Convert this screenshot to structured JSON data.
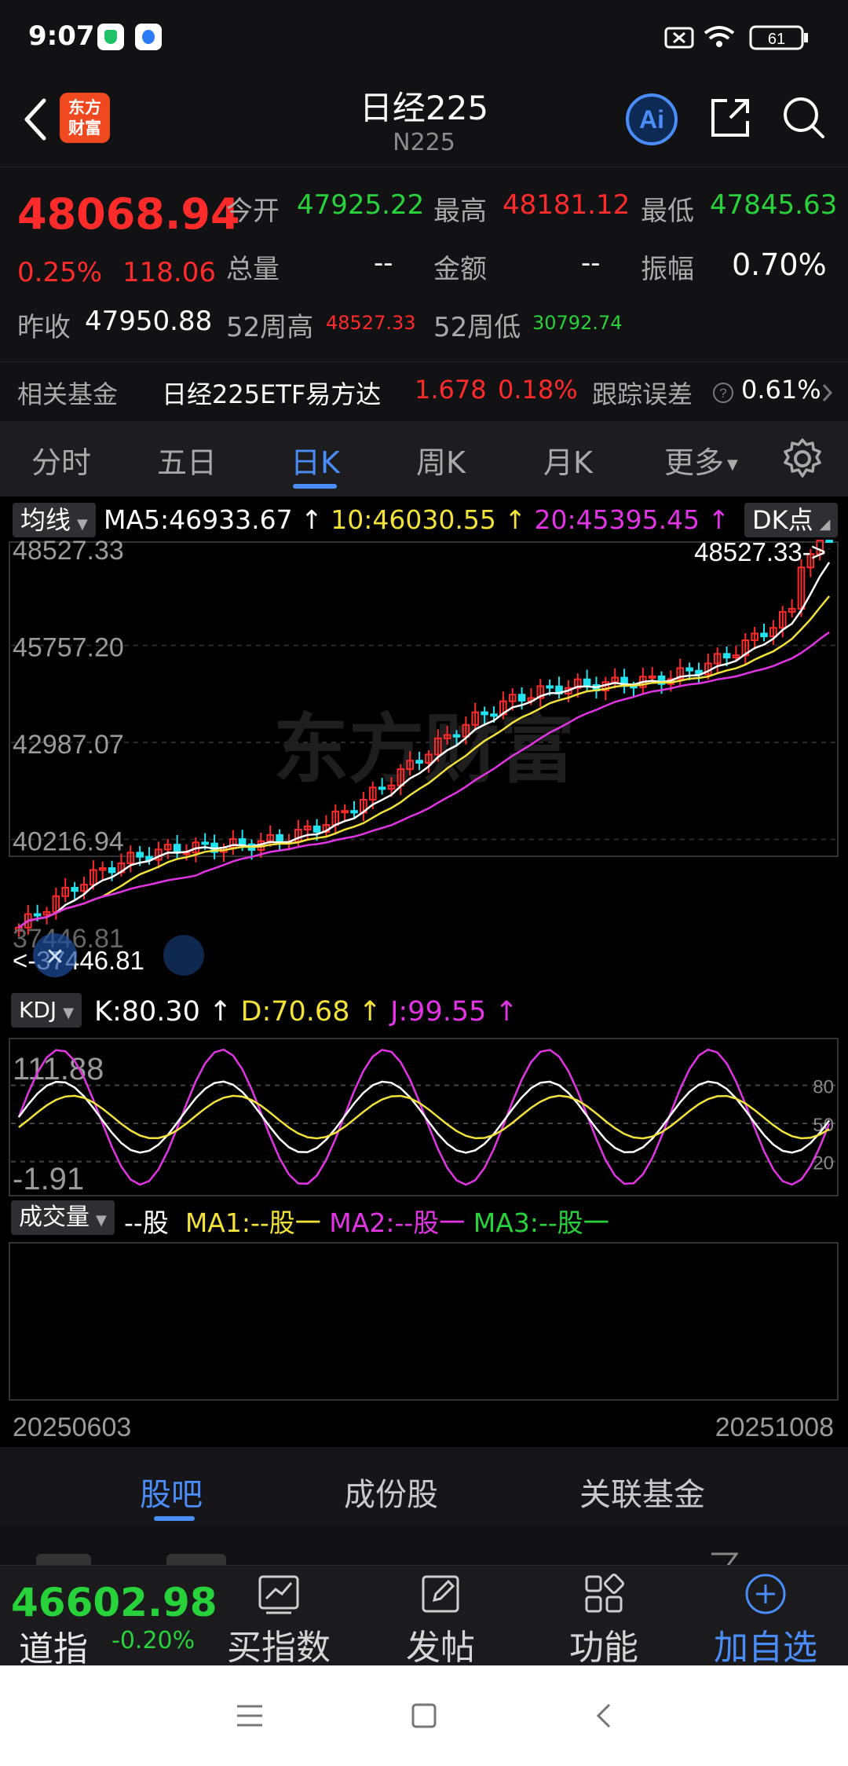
{
  "status": {
    "time": "9:07",
    "battery": "61"
  },
  "header": {
    "logo_line1": "东方",
    "logo_line2": "财富",
    "title": "日经225",
    "code": "N225"
  },
  "quote": {
    "price": "48068.94",
    "change_pct": "0.25%",
    "change": "118.06",
    "prev_close_label": "昨收",
    "prev_close": "47950.88",
    "open_label": "今开",
    "open": "47925.22",
    "high_label": "最高",
    "high": "48181.12",
    "low_label": "最低",
    "low": "47845.63",
    "volume_label": "总量",
    "volume": "--",
    "amount_label": "金额",
    "amount": "--",
    "amplitude_label": "振幅",
    "amplitude": "0.70%",
    "wk52_high_label": "52周高",
    "wk52_high": "48527.33",
    "wk52_low_label": "52周低",
    "wk52_low": "30792.74"
  },
  "fund": {
    "label": "相关基金",
    "name": "日经225ETF易方达",
    "price": "1.678",
    "pct": "0.18%",
    "err_label": "跟踪误差",
    "err_value": "0.61%"
  },
  "tabs": [
    {
      "label": "分时"
    },
    {
      "label": "五日"
    },
    {
      "label": "日K"
    },
    {
      "label": "周K"
    },
    {
      "label": "月K"
    },
    {
      "label": "更多"
    }
  ],
  "ma_bar": {
    "selector": "均线",
    "ma5": "MA5:46933.67",
    "ma10": "10:46030.55",
    "ma20": "20:45395.45",
    "dk": "DK点"
  },
  "kdj_bar": {
    "selector": "KDJ",
    "k": "K:80.30",
    "d": "D:70.68",
    "j": "J:99.55"
  },
  "vol_bar": {
    "selector": "成交量",
    "unit": "--股",
    "ma1": "MA1:--股一",
    "ma2": "MA2:--股一",
    "ma3": "MA3:--股一"
  },
  "chart_data": {
    "type": "candlestick",
    "y_ticks": [
      "48527.33",
      "45757.20",
      "42987.07",
      "40216.94",
      "37446.81"
    ],
    "ylim": [
      37446.81,
      48527.33
    ],
    "max_label": "48527.33->",
    "min_label": "<-37446.81",
    "kdj_ticks": [
      "111.88",
      "-1.91"
    ],
    "kdj_ylim": [
      -1.91,
      111.88
    ],
    "kdj_guides": [
      "80",
      "50",
      "20"
    ],
    "x_start": "20250603",
    "x_end": "20251008",
    "watermark": "东方财富"
  },
  "bottom_tabs": [
    {
      "label": "股吧"
    },
    {
      "label": "成份股"
    },
    {
      "label": "关联基金"
    }
  ],
  "action_bar": {
    "dj_value": "46602.98",
    "dj_name": "道指",
    "dj_change": "-0.20%",
    "buy": "买指数",
    "post": "发帖",
    "func": "功能",
    "add": "加自选"
  },
  "colors": {
    "up": "#ff2b2b",
    "down": "#27d23b",
    "accent": "#4b8df8",
    "ma5": "#ffffff",
    "ma10": "#f2e23a",
    "ma20": "#e233e4"
  }
}
